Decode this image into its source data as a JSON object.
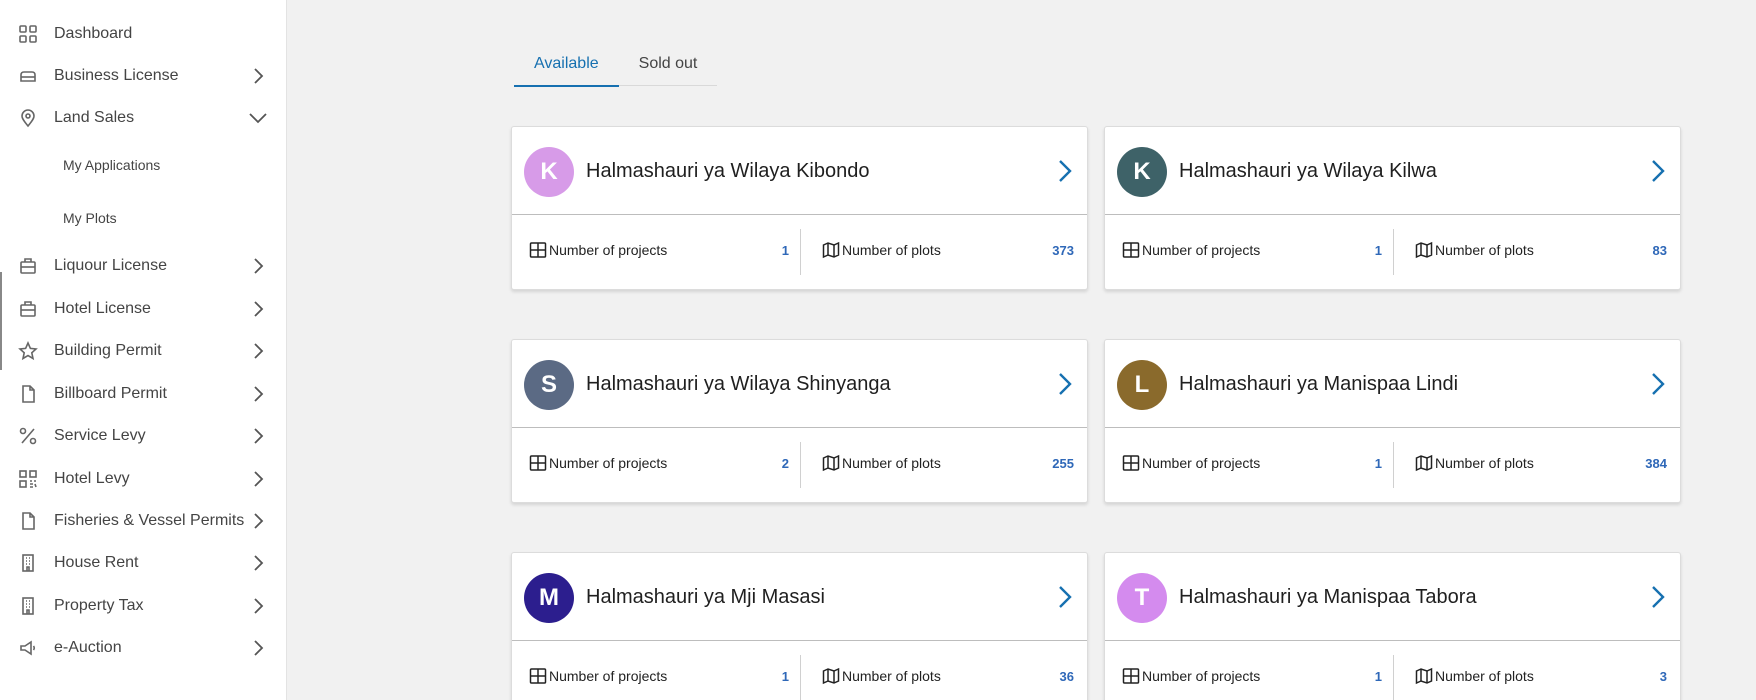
{
  "sidebar": {
    "items": [
      {
        "label": "Dashboard",
        "icon": "grid-icon",
        "chevron": "none"
      },
      {
        "label": "Business License",
        "icon": "briefcase-icon",
        "chevron": "right"
      },
      {
        "label": "Land Sales",
        "icon": "location-pin-icon",
        "chevron": "down"
      },
      {
        "label": "Liquour License",
        "icon": "briefcase-icon",
        "chevron": "right"
      },
      {
        "label": "Hotel License",
        "icon": "briefcase-icon",
        "chevron": "right"
      },
      {
        "label": "Building Permit",
        "icon": "star-icon",
        "chevron": "right"
      },
      {
        "label": "Billboard Permit",
        "icon": "document-icon",
        "chevron": "right"
      },
      {
        "label": "Service Levy",
        "icon": "percent-icon",
        "chevron": "right"
      },
      {
        "label": "Hotel Levy",
        "icon": "qr-code-icon",
        "chevron": "right"
      },
      {
        "label": "Fisheries & Vessel Permits",
        "icon": "document-icon",
        "chevron": "right"
      },
      {
        "label": "House Rent",
        "icon": "building-icon",
        "chevron": "right"
      },
      {
        "label": "Property Tax",
        "icon": "building-icon",
        "chevron": "right"
      },
      {
        "label": "e-Auction",
        "icon": "megaphone-icon",
        "chevron": "right"
      }
    ],
    "sub_items": [
      {
        "label": "My Applications"
      },
      {
        "label": "My Plots"
      }
    ]
  },
  "tabs": [
    {
      "label": "Available",
      "active": true
    },
    {
      "label": "Sold out",
      "active": false
    }
  ],
  "cards": [
    {
      "initial": "K",
      "color": "#d79be8",
      "title": "Halmashauri ya Wilaya Kibondo",
      "projects_label": "Number of projects",
      "projects": "1",
      "plots_label": "Number of plots",
      "plots": "373"
    },
    {
      "initial": "K",
      "color": "#3e6268",
      "title": "Halmashauri ya Wilaya Kilwa",
      "projects_label": "Number of projects",
      "projects": "1",
      "plots_label": "Number of plots",
      "plots": "83"
    },
    {
      "initial": "S",
      "color": "#5b6a84",
      "title": "Halmashauri ya Wilaya Shinyanga",
      "projects_label": "Number of projects",
      "projects": "2",
      "plots_label": "Number of plots",
      "plots": "255"
    },
    {
      "initial": "L",
      "color": "#8a6a2c",
      "title": "Halmashauri ya Manispaa Lindi",
      "projects_label": "Number of projects",
      "projects": "1",
      "plots_label": "Number of plots",
      "plots": "384"
    },
    {
      "initial": "M",
      "color": "#2c1e8e",
      "title": "Halmashauri ya Mji Masasi",
      "projects_label": "Number of projects",
      "projects": "1",
      "plots_label": "Number of plots",
      "plots": "36"
    },
    {
      "initial": "T",
      "color": "#d48bee",
      "title": "Halmashauri ya Manispaa Tabora",
      "projects_label": "Number of projects",
      "projects": "1",
      "plots_label": "Number of plots",
      "plots": "3"
    }
  ],
  "colors": {
    "accent": "#1670b0",
    "stat_value": "#2f68b8"
  }
}
